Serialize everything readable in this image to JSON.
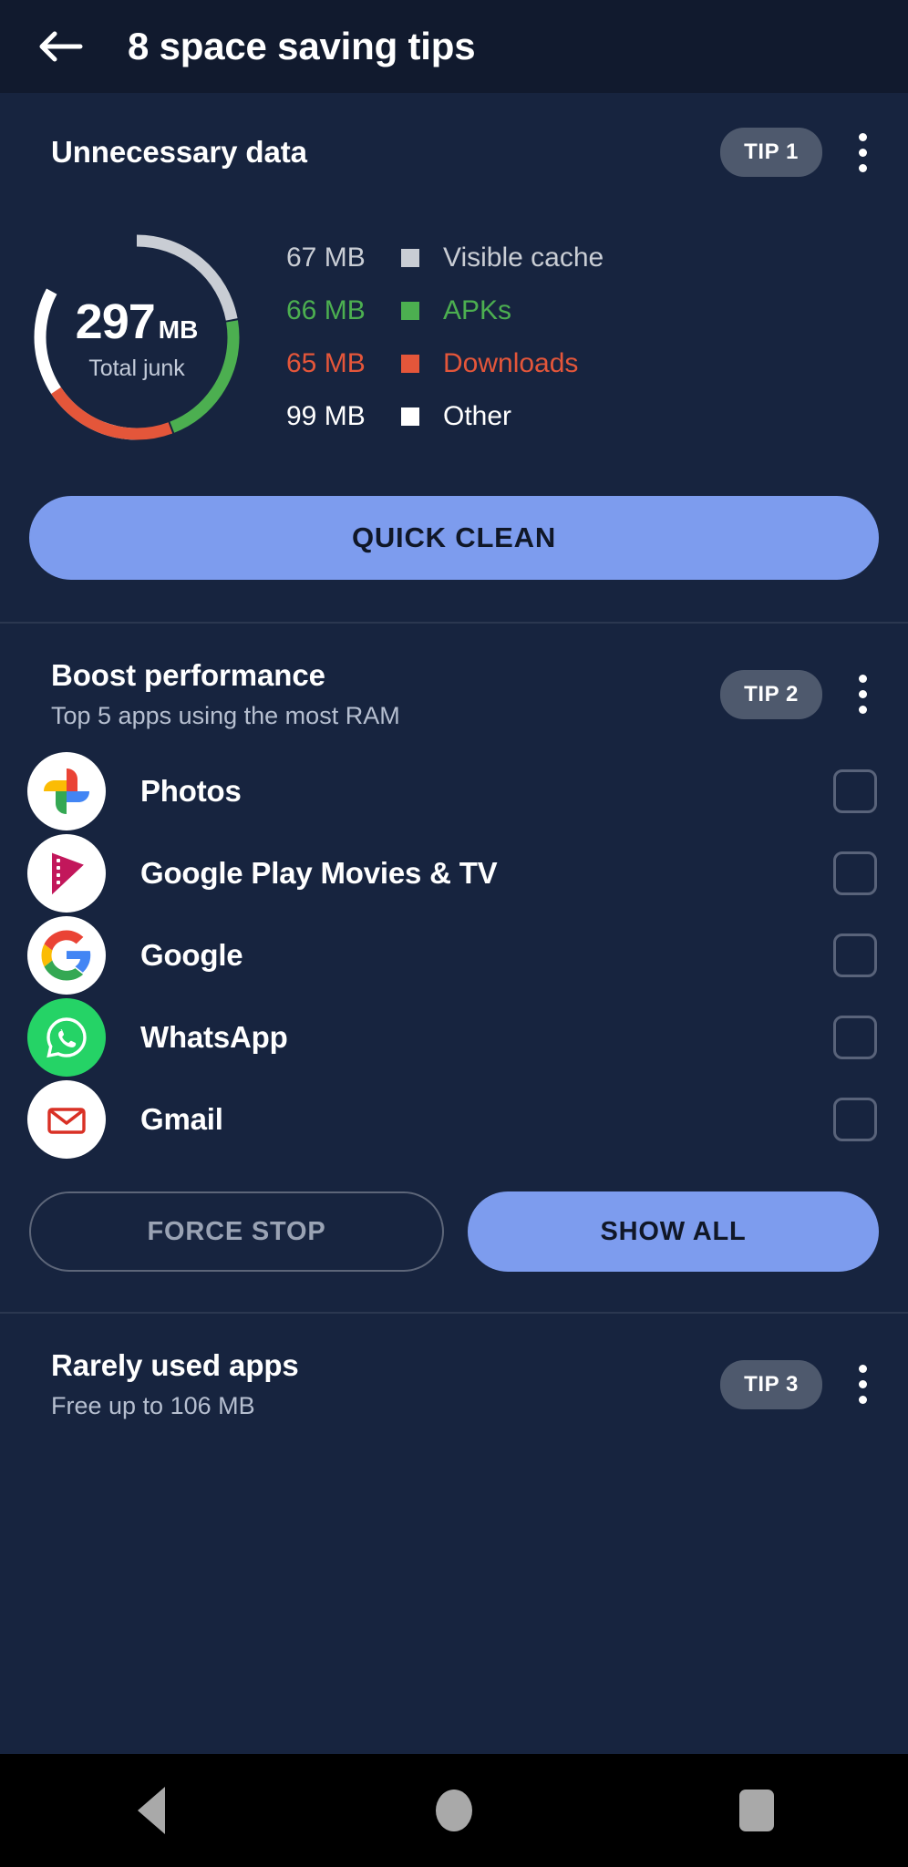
{
  "appbar": {
    "back_icon": "back-arrow-icon",
    "title": "8 space saving tips"
  },
  "colors": {
    "background": "#17243f",
    "appbar_background": "#111a2e",
    "accent_blue": "#7d9cee",
    "pill_grey": "#4e596d",
    "green": "#4caf50",
    "red": "#e4563a",
    "light_grey": "#c9cdd4",
    "white": "#ffffff"
  },
  "cards": [
    {
      "title": "Unnecessary data",
      "tip_label": "TIP 1",
      "menu_icon": "kebab-menu-icon",
      "action_label": "QUICK CLEAN"
    },
    {
      "title": "Boost performance",
      "subtitle": "Top 5 apps using the most RAM",
      "tip_label": "TIP 2",
      "menu_icon": "kebab-menu-icon",
      "secondary_action": "FORCE STOP",
      "primary_action": "SHOW ALL"
    },
    {
      "title": "Rarely used apps",
      "subtitle": "Free up to 106 MB",
      "tip_label": "TIP 3",
      "menu_icon": "kebab-menu-icon"
    }
  ],
  "junk": {
    "total_value": "297",
    "total_unit": "MB",
    "total_label": "Total junk",
    "legend": [
      {
        "size": "67 MB",
        "name": "Visible cache",
        "color": "#c9cdd4"
      },
      {
        "size": "66 MB",
        "name": "APKs",
        "color": "#4caf50"
      },
      {
        "size": "65 MB",
        "name": "Downloads",
        "color": "#e4563a"
      },
      {
        "size": "99 MB",
        "name": "Other",
        "color": "#ffffff"
      }
    ]
  },
  "chart_data": {
    "type": "pie",
    "title": "Total junk",
    "categories": [
      "Visible cache",
      "APKs",
      "Downloads",
      "Other"
    ],
    "values": [
      67,
      66,
      65,
      99
    ],
    "unit": "MB",
    "total": 297,
    "colors": [
      "#c9cdd4",
      "#4caf50",
      "#e4563a",
      "#ffffff"
    ],
    "legend": "right"
  },
  "apps": [
    {
      "name": "Photos",
      "icon": "google-photos-icon",
      "checked": false
    },
    {
      "name": "Google Play Movies & TV",
      "icon": "google-play-movies-icon",
      "checked": false
    },
    {
      "name": "Google",
      "icon": "google-icon",
      "checked": false
    },
    {
      "name": "WhatsApp",
      "icon": "whatsapp-icon",
      "checked": false
    },
    {
      "name": "Gmail",
      "icon": "gmail-icon",
      "checked": false
    }
  ],
  "navbar": {
    "back": "nav-back-icon",
    "home": "nav-home-icon",
    "recents": "nav-recents-icon"
  }
}
